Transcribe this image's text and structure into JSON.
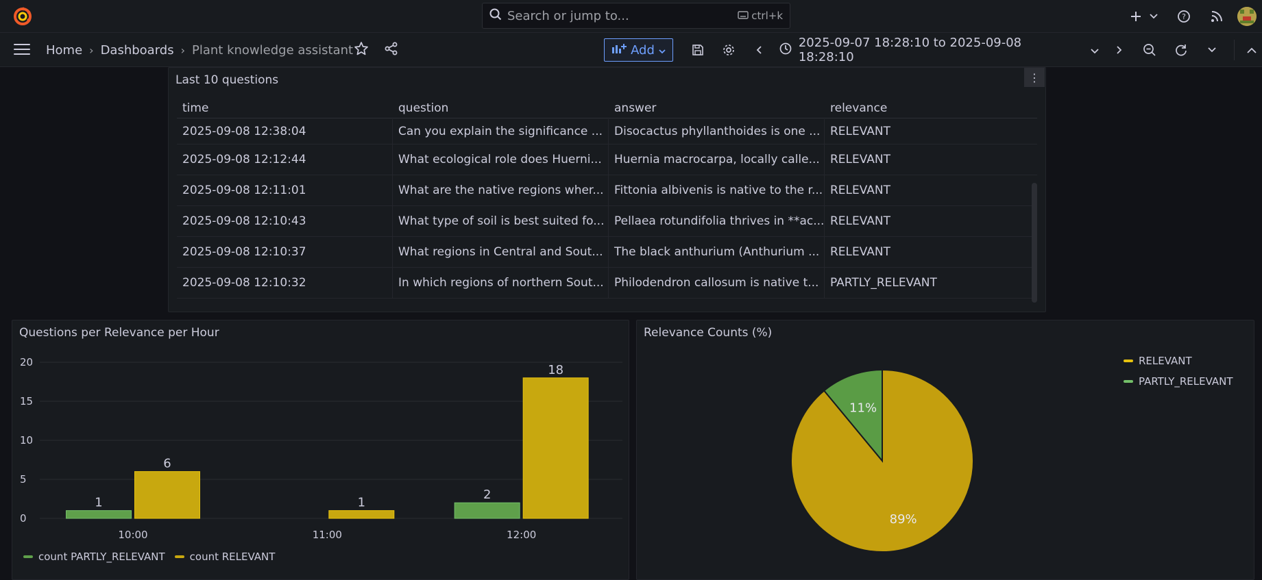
{
  "topbar": {
    "search_placeholder": "Search or jump to...",
    "search_shortcut": "ctrl+k",
    "icons": [
      "grafana-logo-icon",
      "plus-icon",
      "chevron-down-icon",
      "help-icon",
      "rss-icon",
      "avatar"
    ]
  },
  "navbar": {
    "breadcrumbs": [
      "Home",
      "Dashboards",
      "Plant knowledge assistant"
    ],
    "add_label": "Add",
    "time_range": "2025-09-07 18:28:10 to 2025-09-08 18:28:10",
    "accent_color": "#6e9fff"
  },
  "table_panel": {
    "title": "Last 10 questions",
    "columns": [
      "time",
      "question",
      "answer",
      "relevance"
    ],
    "rows": [
      [
        "2025-09-08 12:38:04",
        "Can you explain the significance ...",
        "Disocactus phyllanthoides is one ...",
        "RELEVANT"
      ],
      [
        "2025-09-08 12:12:44",
        "What ecological role does Huerni...",
        "Huernia macrocarpa, locally calle...",
        "RELEVANT"
      ],
      [
        "2025-09-08 12:11:01",
        "What are the native regions wher...",
        "Fittonia albivenis is native to the r...",
        "RELEVANT"
      ],
      [
        "2025-09-08 12:10:43",
        "What type of soil is best suited fo...",
        "Pellaea rotundifolia thrives in **ac...",
        "RELEVANT"
      ],
      [
        "2025-09-08 12:10:37",
        "What regions in Central and Sout...",
        "The black anthurium (Anthurium ...",
        "RELEVANT"
      ],
      [
        "2025-09-08 12:10:32",
        "In which regions of northern Sout...",
        "Philodendron callosum is native t...",
        "PARTLY_RELEVANT"
      ]
    ]
  },
  "bar_panel": {
    "title": "Questions per Relevance per Hour",
    "legend": [
      "count PARTLY_RELEVANT",
      "count RELEVANT"
    ]
  },
  "pie_panel": {
    "title": "Relevance Counts (%)",
    "legend": [
      "RELEVANT",
      "PARTLY_RELEVANT"
    ],
    "labels": [
      "89%",
      "11%"
    ]
  },
  "colors": {
    "relevant": "#c8a80f",
    "partly_relevant": "#5fa04b"
  },
  "chart_data": [
    {
      "type": "bar",
      "title": "Questions per Relevance per Hour",
      "categories": [
        "10:00",
        "11:00",
        "12:00"
      ],
      "series": [
        {
          "name": "count PARTLY_RELEVANT",
          "values": [
            1,
            0,
            2
          ],
          "color": "#5fa04b"
        },
        {
          "name": "count RELEVANT",
          "values": [
            6,
            1,
            18
          ],
          "color": "#c8a80f"
        }
      ],
      "ylim": [
        0,
        20
      ],
      "yticks": [
        0,
        5,
        10,
        15,
        20
      ],
      "grid": true,
      "legend": "bottom-left"
    },
    {
      "type": "pie",
      "title": "Relevance Counts (%)",
      "slices": [
        {
          "name": "RELEVANT",
          "value": 89,
          "label": "89%",
          "color": "#c8a80f"
        },
        {
          "name": "PARTLY_RELEVANT",
          "value": 11,
          "label": "11%",
          "color": "#5fa04b"
        }
      ],
      "legend": "top-right"
    }
  ]
}
